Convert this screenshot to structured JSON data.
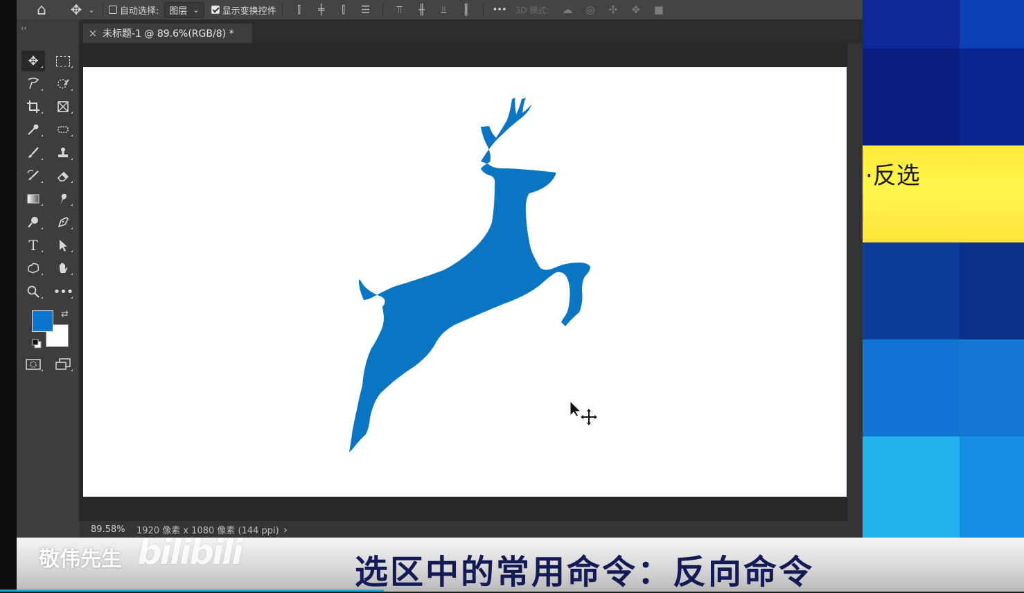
{
  "options_bar": {
    "auto_select_label": "自动选择:",
    "auto_select_checked": false,
    "auto_select_target": "图层",
    "show_transform_label": "显示变换控件",
    "show_transform_checked": true,
    "more_label": "•••",
    "mode_3d_label": "3D 模式:"
  },
  "document": {
    "tab_close": "×",
    "tab_title": "未标题-1 @ 89.6%(RGB/8) *"
  },
  "toolbar": {
    "collapse_label": "‹‹",
    "foreground_color": "#0a75cf",
    "background_color": "#ffffff"
  },
  "status_bar": {
    "zoom": "89.58%",
    "doc_info": "1920 像素 x 1080 像素 (144 ppi)",
    "arrow": "›"
  },
  "canvas": {
    "shape_color": "#0a75c2"
  },
  "side_panel": {
    "highlight_text": "·反选"
  },
  "caption": {
    "watermark_name": "敬伟先生",
    "watermark_logo": "bilibili",
    "subtitle": "选区中的常用命令：反向命令"
  },
  "video": {
    "progress": 0.375
  }
}
